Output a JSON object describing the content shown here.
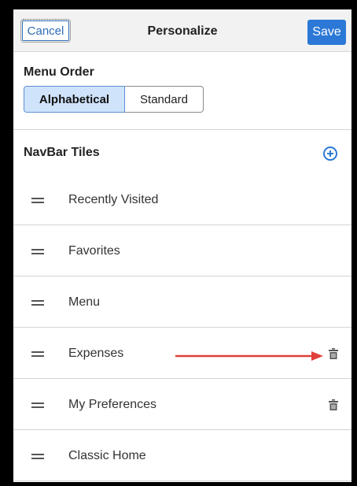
{
  "header": {
    "cancel_label": "Cancel",
    "title": "Personalize",
    "save_label": "Save"
  },
  "menu_order": {
    "label": "Menu Order",
    "options": [
      "Alphabetical",
      "Standard"
    ],
    "selected": "Alphabetical"
  },
  "navbar_tiles": {
    "label": "NavBar Tiles",
    "items": [
      {
        "label": "Recently Visited",
        "removable": false
      },
      {
        "label": "Favorites",
        "removable": false
      },
      {
        "label": "Menu",
        "removable": false
      },
      {
        "label": "Expenses",
        "removable": true
      },
      {
        "label": "My Preferences",
        "removable": true
      },
      {
        "label": "Classic Home",
        "removable": false
      }
    ]
  },
  "icons": {
    "add": "plus-circle-icon",
    "drag": "drag-handle-icon",
    "delete": "trash-icon",
    "annotation": "red-arrow-annotation"
  },
  "colors": {
    "accent": "#2b78d6",
    "selected_segment": "#cfe3fb",
    "annotation_arrow": "#e0403a",
    "header_bg": "#f2f2f2"
  }
}
